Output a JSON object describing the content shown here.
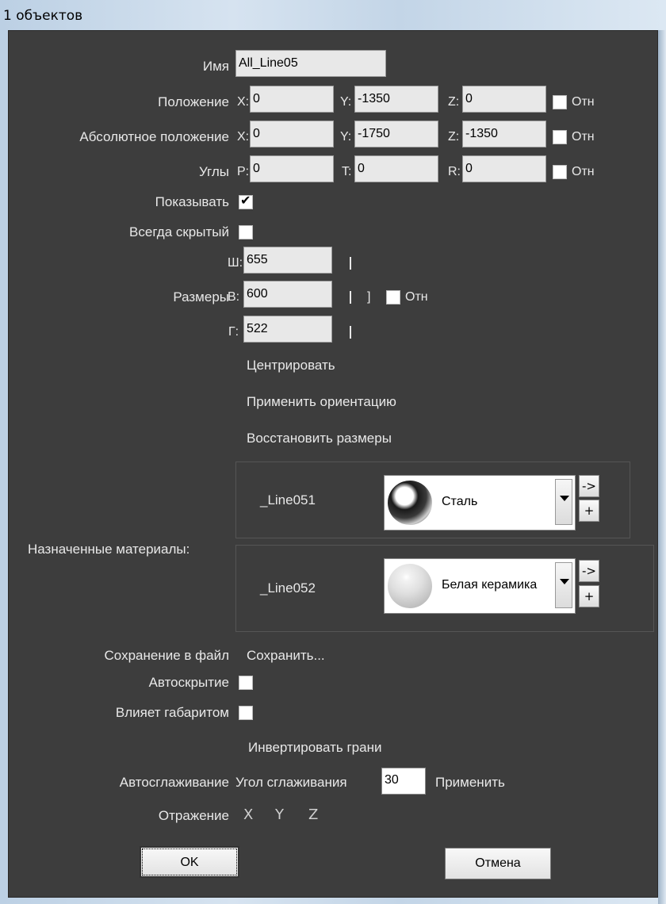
{
  "window": {
    "title": "1 объектов"
  },
  "name": {
    "label": "Имя",
    "value": "All_Line05"
  },
  "position": {
    "label": "Положение",
    "x_label": "X:",
    "x": "0",
    "y_label": "Y:",
    "y": "-1350",
    "z_label": "Z:",
    "z": "0",
    "rel_label": "Отн"
  },
  "abs_position": {
    "label": "Абсолютное положение",
    "x_label": "X:",
    "x": "0",
    "y_label": "Y:",
    "y": "-1750",
    "z_label": "Z:",
    "z": "-1350",
    "rel_label": "Отн"
  },
  "angles": {
    "label": "Углы",
    "p_label": "P:",
    "p": "0",
    "t_label": "T:",
    "t": "0",
    "r_label": "R:",
    "r": "0",
    "rel_label": "Отн"
  },
  "show": {
    "label": "Показывать",
    "checked": true
  },
  "always_hidden": {
    "label": "Всегда скрытый",
    "checked": false
  },
  "sizes": {
    "label": "Размеры",
    "w_label": "Ш:",
    "w": "655",
    "h_label": "В:",
    "h": "600",
    "d_label": "Г:",
    "d": "522",
    "bracket": "]",
    "rel_label": "Отн"
  },
  "actions": {
    "center": "Центрировать",
    "apply_orientation": "Применить ориентацию",
    "restore_sizes": "Восстановить размеры"
  },
  "materials": {
    "label": "Назначенные материалы:",
    "items": [
      {
        "name": "_Line051",
        "material": "Сталь",
        "sphere": "steel",
        "arrow": "->",
        "plus": "+"
      },
      {
        "name": "_Line052",
        "material": "Белая керамика",
        "sphere": "ceramic",
        "arrow": "->",
        "plus": "+"
      }
    ]
  },
  "save": {
    "label": "Сохранение в файл",
    "link": "Сохранить..."
  },
  "autohide": {
    "label": "Автоскрытие",
    "checked": false
  },
  "affects_bounds": {
    "label": "Влияет габаритом",
    "checked": false
  },
  "invert_faces": "Инвертировать грани",
  "autosmooth": {
    "label": "Автосглаживание",
    "angle_label": "Угол сглаживания",
    "angle": "30",
    "apply": "Применить"
  },
  "mirror": {
    "label": "Отражение",
    "x": "X",
    "y": "Y",
    "z": "Z"
  },
  "buttons": {
    "ok": "OK",
    "cancel": "Отмена"
  }
}
